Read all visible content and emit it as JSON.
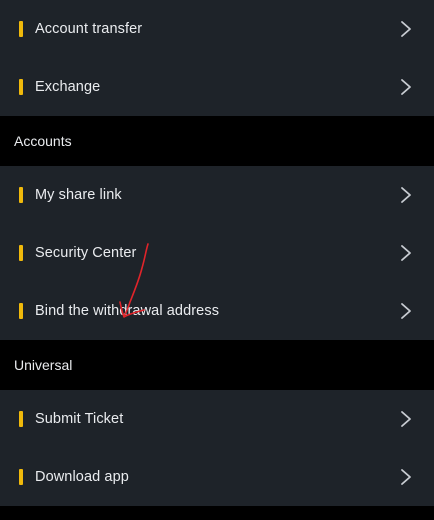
{
  "groups": [
    {
      "items": [
        {
          "label": "Account transfer"
        },
        {
          "label": "Exchange"
        }
      ]
    },
    {
      "title": "Accounts",
      "items": [
        {
          "label": "My share link"
        },
        {
          "label": "Security Center"
        },
        {
          "label": "Bind the withdrawal address"
        }
      ]
    },
    {
      "title": "Universal",
      "items": [
        {
          "label": "Submit Ticket"
        },
        {
          "label": "Download app"
        }
      ]
    }
  ],
  "icons": {
    "marker": "yellow-bar",
    "chevron": "chevron-right-icon",
    "annotation": "hand-drawn-arrow"
  },
  "colors": {
    "accent": "#f0b90b",
    "row_background": "#1e2329",
    "section_background": "#000000",
    "text": "#eaecef",
    "chevron": "#c8ccd2",
    "annotation": "#e0242a"
  }
}
